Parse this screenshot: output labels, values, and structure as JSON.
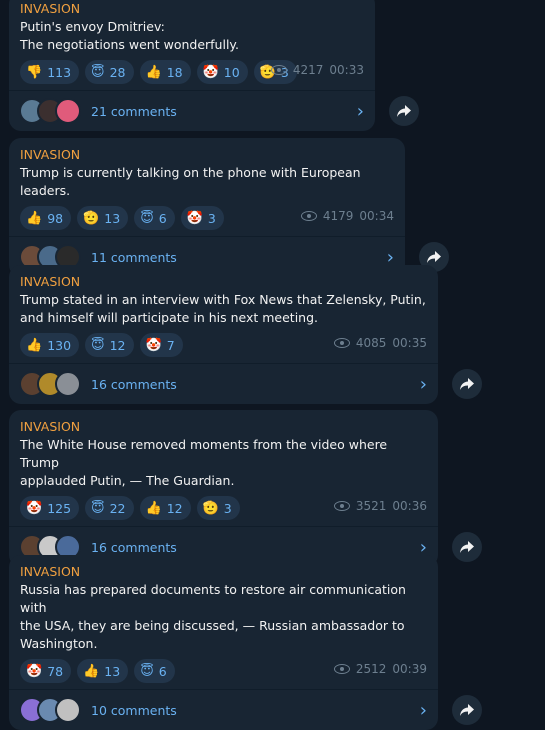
{
  "posts": [
    {
      "channel": "INVASION",
      "lines": [
        "Putin's envoy Dmitriev:",
        "The negotiations went wonderfully."
      ],
      "reactions": [
        {
          "icon": "👎",
          "count": "113"
        },
        {
          "icon": "😇",
          "count": "28"
        },
        {
          "icon": "👍",
          "count": "18"
        },
        {
          "icon": "🤡",
          "count": "10"
        },
        {
          "icon": "🫡",
          "count": "3"
        }
      ],
      "views": "4217",
      "time": "00:33",
      "comments": "21 comments",
      "avatar_colors": [
        "#5a7a94",
        "#3b2f2f",
        "#e05b7b"
      ]
    },
    {
      "channel": "INVASION",
      "lines": [
        "Trump is currently talking on the phone with European leaders."
      ],
      "reactions": [
        {
          "icon": "👍",
          "count": "98"
        },
        {
          "icon": "🫡",
          "count": "13"
        },
        {
          "icon": "😇",
          "count": "6"
        },
        {
          "icon": "🤡",
          "count": "3"
        }
      ],
      "views": "4179",
      "time": "00:34",
      "comments": "11 comments",
      "avatar_colors": [
        "#6b4b3a",
        "#4a6a8a",
        "#2a2a2a"
      ]
    },
    {
      "channel": "INVASION",
      "lines": [
        "Trump stated in an interview with Fox News that Zelensky, Putin,",
        "and himself will participate in his next meeting."
      ],
      "reactions": [
        {
          "icon": "👍",
          "count": "130"
        },
        {
          "icon": "😇",
          "count": "12"
        },
        {
          "icon": "🤡",
          "count": "7"
        }
      ],
      "views": "4085",
      "time": "00:35",
      "comments": "16 comments",
      "avatar_colors": [
        "#5b4030",
        "#b08a2a",
        "#8a8f96"
      ]
    },
    {
      "channel": "INVASION",
      "lines": [
        "The White House removed moments from the video where Trump",
        "applauded Putin, — The Guardian."
      ],
      "reactions": [
        {
          "icon": "🤡",
          "count": "125"
        },
        {
          "icon": "😇",
          "count": "22"
        },
        {
          "icon": "👍",
          "count": "12"
        },
        {
          "icon": "🫡",
          "count": "3"
        }
      ],
      "views": "3521",
      "time": "00:36",
      "comments": "16 comments",
      "avatar_colors": [
        "#5b4030",
        "#c9c9c9",
        "#4a6a9a"
      ]
    },
    {
      "channel": "INVASION",
      "lines": [
        "Russia has prepared documents to restore air communication with",
        "the USA, they are being discussed, — Russian ambassador to",
        "Washington."
      ],
      "reactions": [
        {
          "icon": "🤡",
          "count": "78"
        },
        {
          "icon": "👍",
          "count": "13"
        },
        {
          "icon": "😇",
          "count": "6"
        }
      ],
      "views": "2512",
      "time": "00:39",
      "comments": "10 comments",
      "avatar_colors": [
        "#8a6fd6",
        "#6a8ab0",
        "#c0c0c0"
      ]
    }
  ],
  "icons": {
    "share": "share-icon",
    "chevron": "chevron-right-icon",
    "views": "eye-icon"
  }
}
